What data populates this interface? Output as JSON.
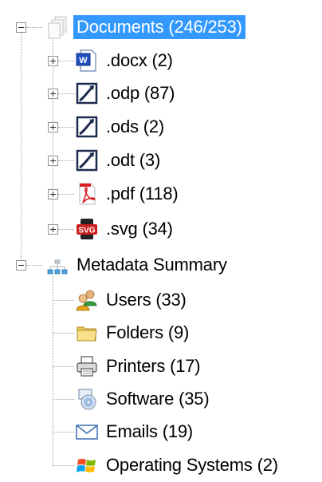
{
  "tree": {
    "documents": {
      "label": "Documents (246/253)",
      "icon": "documents-icon",
      "expanded": true,
      "selected": true,
      "children": [
        {
          "label": ".docx (2)",
          "icon": "word-document-icon"
        },
        {
          "label": ".odp (87)",
          "icon": "openoffice-icon"
        },
        {
          "label": ".ods (2)",
          "icon": "openoffice-icon"
        },
        {
          "label": ".odt (3)",
          "icon": "openoffice-icon"
        },
        {
          "label": ".pdf (118)",
          "icon": "pdf-icon"
        },
        {
          "label": ".svg (34)",
          "icon": "svg-icon"
        }
      ]
    },
    "metadata": {
      "label": "Metadata Summary",
      "icon": "network-icon",
      "expanded": true,
      "children": [
        {
          "label": "Users (33)",
          "icon": "users-icon"
        },
        {
          "label": "Folders (9)",
          "icon": "folder-icon"
        },
        {
          "label": "Printers (17)",
          "icon": "printer-icon"
        },
        {
          "label": "Software (35)",
          "icon": "software-icon"
        },
        {
          "label": "Emails (19)",
          "icon": "email-icon"
        },
        {
          "label": "Operating Systems (2)",
          "icon": "windows-logo-icon"
        }
      ]
    }
  },
  "colors": {
    "selection": "#3399ff",
    "selection_text": "#ffffff",
    "guide_lines": "#a0a0a0",
    "pdf_red": "#d71e24",
    "svg_red": "#cc1f1f",
    "word_blue": "#1f4fbf"
  }
}
